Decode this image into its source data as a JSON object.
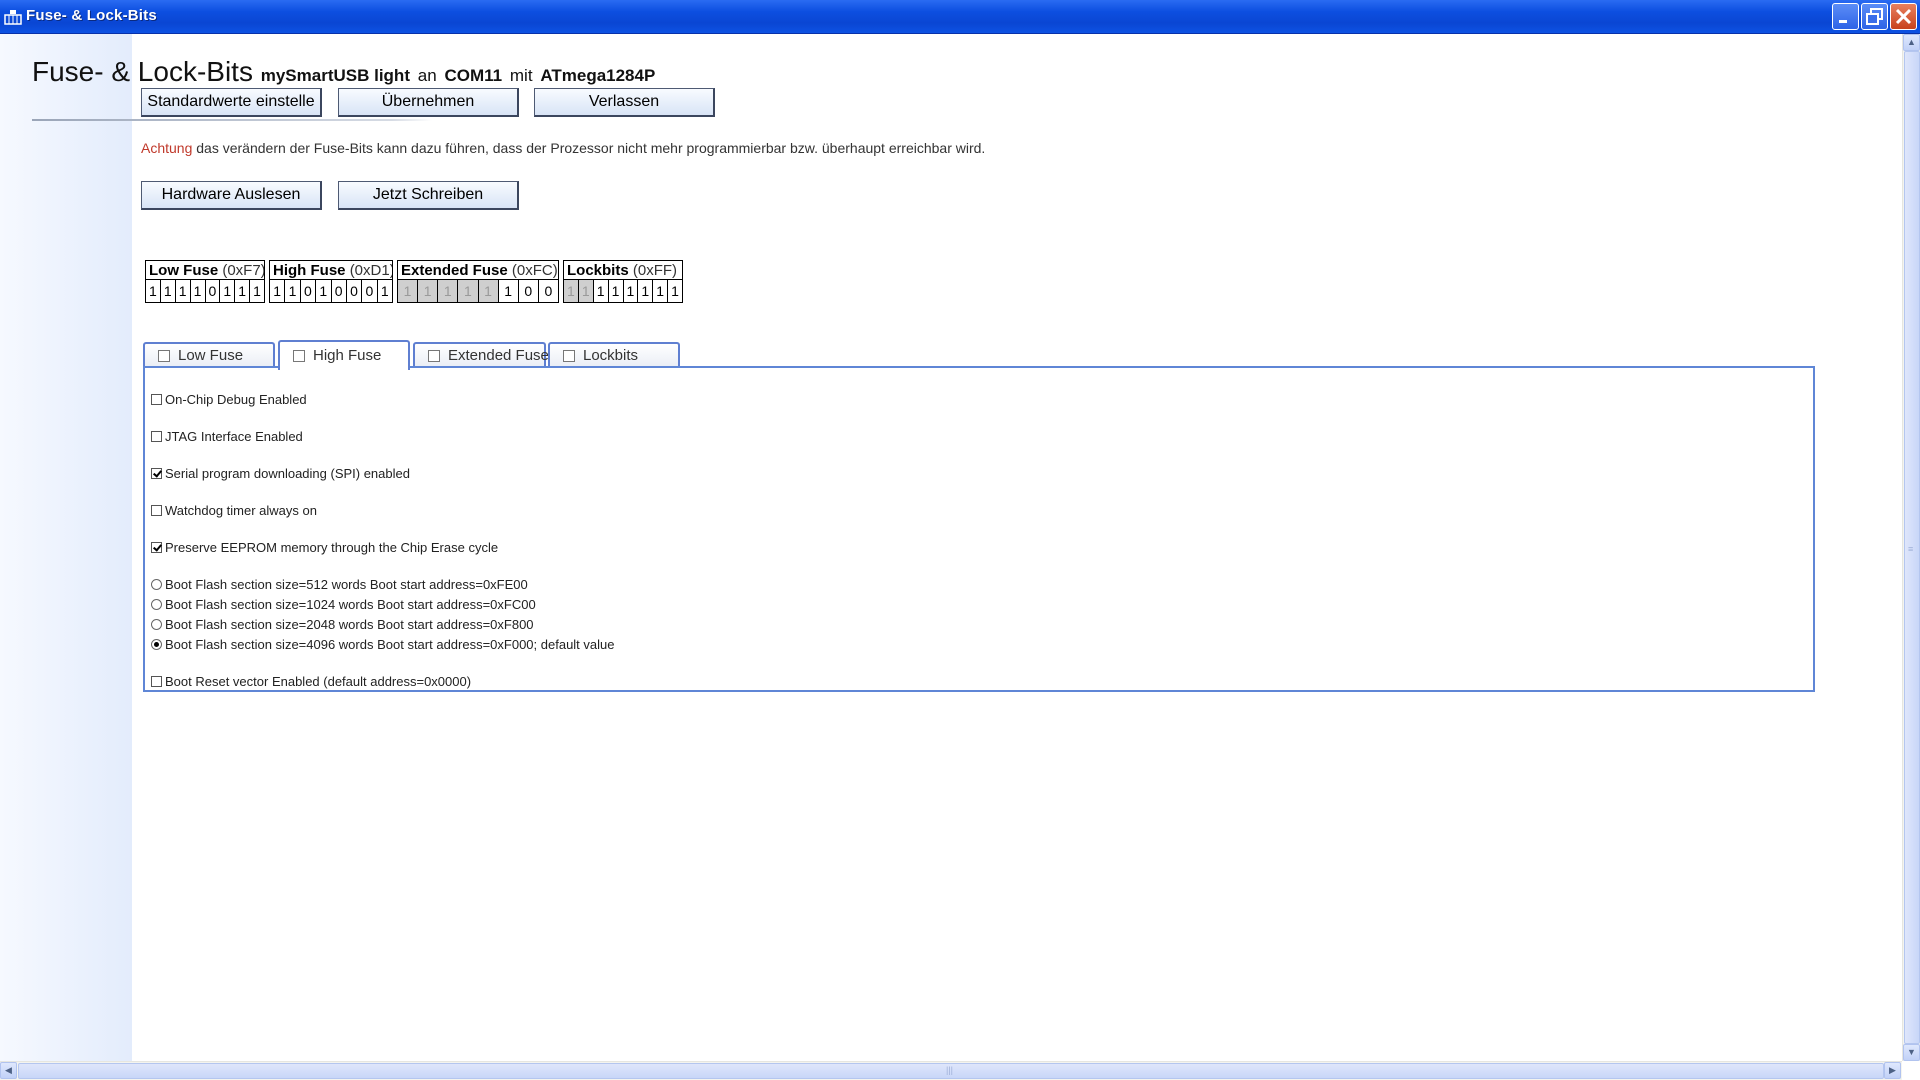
{
  "window": {
    "title": "Fuse- & Lock-Bits"
  },
  "header": {
    "title": "Fuse- & Lock-Bits",
    "device": "mySmartUSB light",
    "an": "an",
    "port": "COM11",
    "mit": "mit",
    "chip": "ATmega1284P"
  },
  "toolbar": {
    "defaults_label": "Standardwerte einstelle",
    "apply_label": "Übernehmen",
    "exit_label": "Verlassen"
  },
  "warning": {
    "keyword": "Achtung",
    "text": "das verändern der Fuse-Bits kann dazu führen, dass der Prozessor nicht mehr programmierbar bzw. überhaupt erreichbar wird."
  },
  "actions": {
    "read_label": "Hardware Auslesen",
    "write_label": "Jetzt Schreiben"
  },
  "fuses": {
    "low": {
      "name": "Low Fuse",
      "hex": "(0xF7)",
      "bits": [
        "1",
        "1",
        "1",
        "1",
        "0",
        "1",
        "1",
        "1"
      ]
    },
    "high": {
      "name": "High Fuse",
      "hex": "(0xD1)",
      "bits": [
        "1",
        "1",
        "0",
        "1",
        "0",
        "0",
        "0",
        "1"
      ]
    },
    "ext": {
      "name": "Extended Fuse",
      "hex": "(0xFC)",
      "bits": [
        "1",
        "1",
        "1",
        "1",
        "1",
        "1",
        "0",
        "0"
      ]
    },
    "lock": {
      "name": "Lockbits",
      "hex": "(0xFF)",
      "bits": [
        "1",
        "1",
        "1",
        "1",
        "1",
        "1",
        "1",
        "1"
      ]
    }
  },
  "tabs": {
    "low": "Low Fuse",
    "high": "High Fuse",
    "ext": "Extended Fuse",
    "lock": "Lockbits"
  },
  "options": {
    "ocd": "On-Chip Debug Enabled",
    "jtag": "JTAG Interface Enabled",
    "spi": "Serial program downloading (SPI) enabled",
    "wdt": "Watchdog timer always on",
    "eesave": "Preserve EEPROM memory through the Chip Erase cycle",
    "boot512": "Boot Flash section size=512 words Boot start address=0xFE00",
    "boot1024": "Boot Flash section size=1024 words Boot start address=0xFC00",
    "boot2048": "Boot Flash section size=2048 words Boot start address=0xF800",
    "boot4096": "Boot Flash section size=4096 words Boot start address=0xF000; default value",
    "bootrst": "Boot Reset vector Enabled (default address=0x0000)"
  },
  "colors": {
    "warning_keyword": "#c0392b",
    "tab_border": "#5f86d6",
    "titlebar": "#0a46d3"
  }
}
